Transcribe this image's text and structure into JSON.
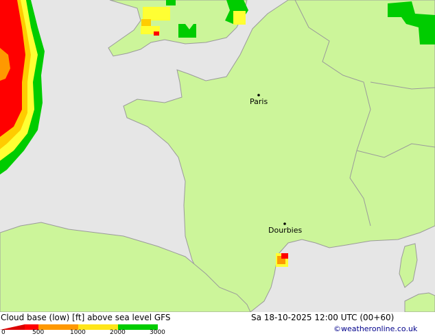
{
  "title": "Cloud base (low) [ft] above sea level GFS",
  "datetime": "Sa 18-10-2025 12:00 UTC (00+60)",
  "credit": "©weatheronline.co.uk",
  "cities": [
    {
      "name": "Paris"
    },
    {
      "name": "Dourbies"
    }
  ],
  "legend": {
    "ticks": [
      "0",
      "500",
      "1000",
      "2000",
      "3000"
    ],
    "colors": [
      "#dd0000",
      "#ff0000",
      "#ff9900",
      "#ffcc00",
      "#ffff33",
      "#00cc00"
    ]
  },
  "colors": {
    "sea": "#e6e6e6",
    "land": "#ccf59a",
    "border": "#9a9a9a"
  }
}
